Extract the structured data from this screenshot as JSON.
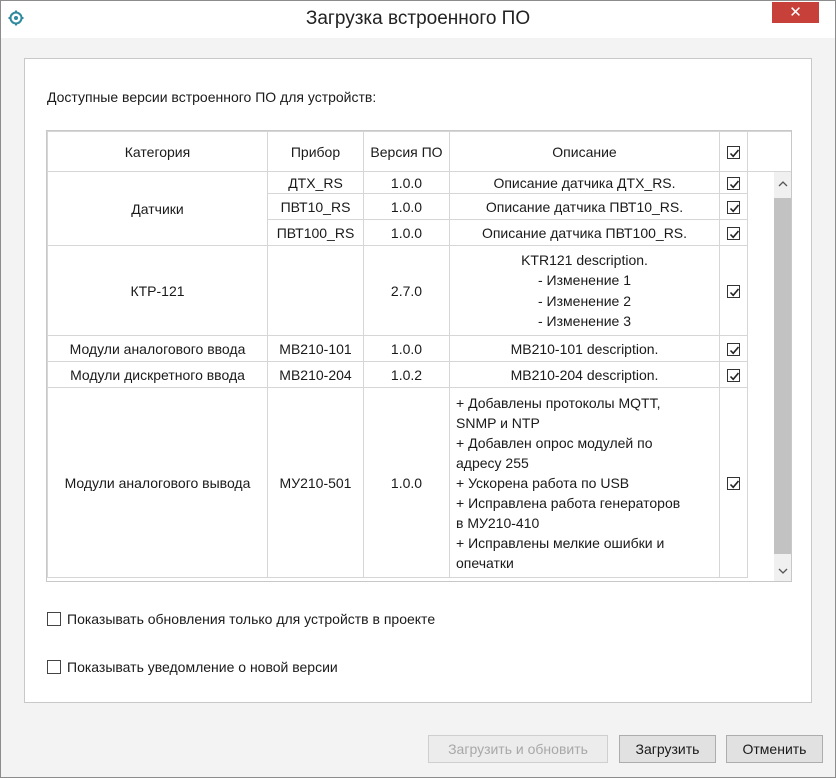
{
  "window": {
    "title": "Загрузка встроенного ПО",
    "close_label": "✕"
  },
  "heading": "Доступные версии встроенного ПО для устройств:",
  "table": {
    "headers": {
      "category": "Категория",
      "device": "Прибор",
      "version": "Версия ПО",
      "description": "Описание"
    },
    "header_checked": true,
    "groups": [
      {
        "category": "Датчики",
        "rows": [
          {
            "device": "ДТХ_RS",
            "version": "1.0.0",
            "description": "Описание датчика ДТХ_RS.",
            "checked": true
          },
          {
            "device": "ПВТ10_RS",
            "version": "1.0.0",
            "description": "Описание датчика ПВТ10_RS.",
            "checked": true
          },
          {
            "device": "ПВТ100_RS",
            "version": "1.0.0",
            "description": "Описание датчика ПВТ100_RS.",
            "checked": true
          }
        ]
      },
      {
        "category": "КТР-121",
        "rows": [
          {
            "device": "",
            "version": "2.7.0",
            "description_lines": [
              "KTR121 description.",
              "- Изменение 1",
              "- Изменение 2",
              "- Изменение 3"
            ],
            "checked": true
          }
        ]
      },
      {
        "category": "Модули аналогового ввода",
        "rows": [
          {
            "device": "МВ210-101",
            "version": "1.0.0",
            "description": "МВ210-101 description.",
            "checked": true
          }
        ]
      },
      {
        "category": "Модули дискретного ввода",
        "rows": [
          {
            "device": "МВ210-204",
            "version": "1.0.2",
            "description": "МВ210-204 description.",
            "checked": true
          }
        ]
      },
      {
        "category": "Модули аналогового вывода",
        "rows": [
          {
            "device": "МУ210-501",
            "version": "1.0.0",
            "description_lines": [
              "+ Добавлены протоколы MQTT,",
              "SNMP и NTP",
              "+ Добавлен опрос модулей по",
              "адресу 255",
              "+ Ускорена работа по USB",
              "+ Исправлена работа генераторов",
              "в МУ210-410",
              "+ Исправлены мелкие ошибки и",
              "опечатки"
            ],
            "checked": true
          }
        ]
      }
    ]
  },
  "options": {
    "only_project_devices": {
      "label": "Показывать обновления только для устройств в проекте",
      "checked": false
    },
    "notify_new_version": {
      "label": "Показывать уведомление о новой версии",
      "checked": false
    }
  },
  "buttons": {
    "load_and_update": {
      "label": "Загрузить и обновить",
      "enabled": false
    },
    "load": {
      "label": "Загрузить"
    },
    "cancel": {
      "label": "Отменить"
    }
  },
  "colors": {
    "close_button": "#c7403a",
    "scroll_thumb": "#c2c2c2"
  },
  "icons": {
    "app": "gear-icon",
    "scroll_up": "chevron-up-icon",
    "scroll_down": "chevron-down-icon",
    "checkbox": "check-icon"
  }
}
